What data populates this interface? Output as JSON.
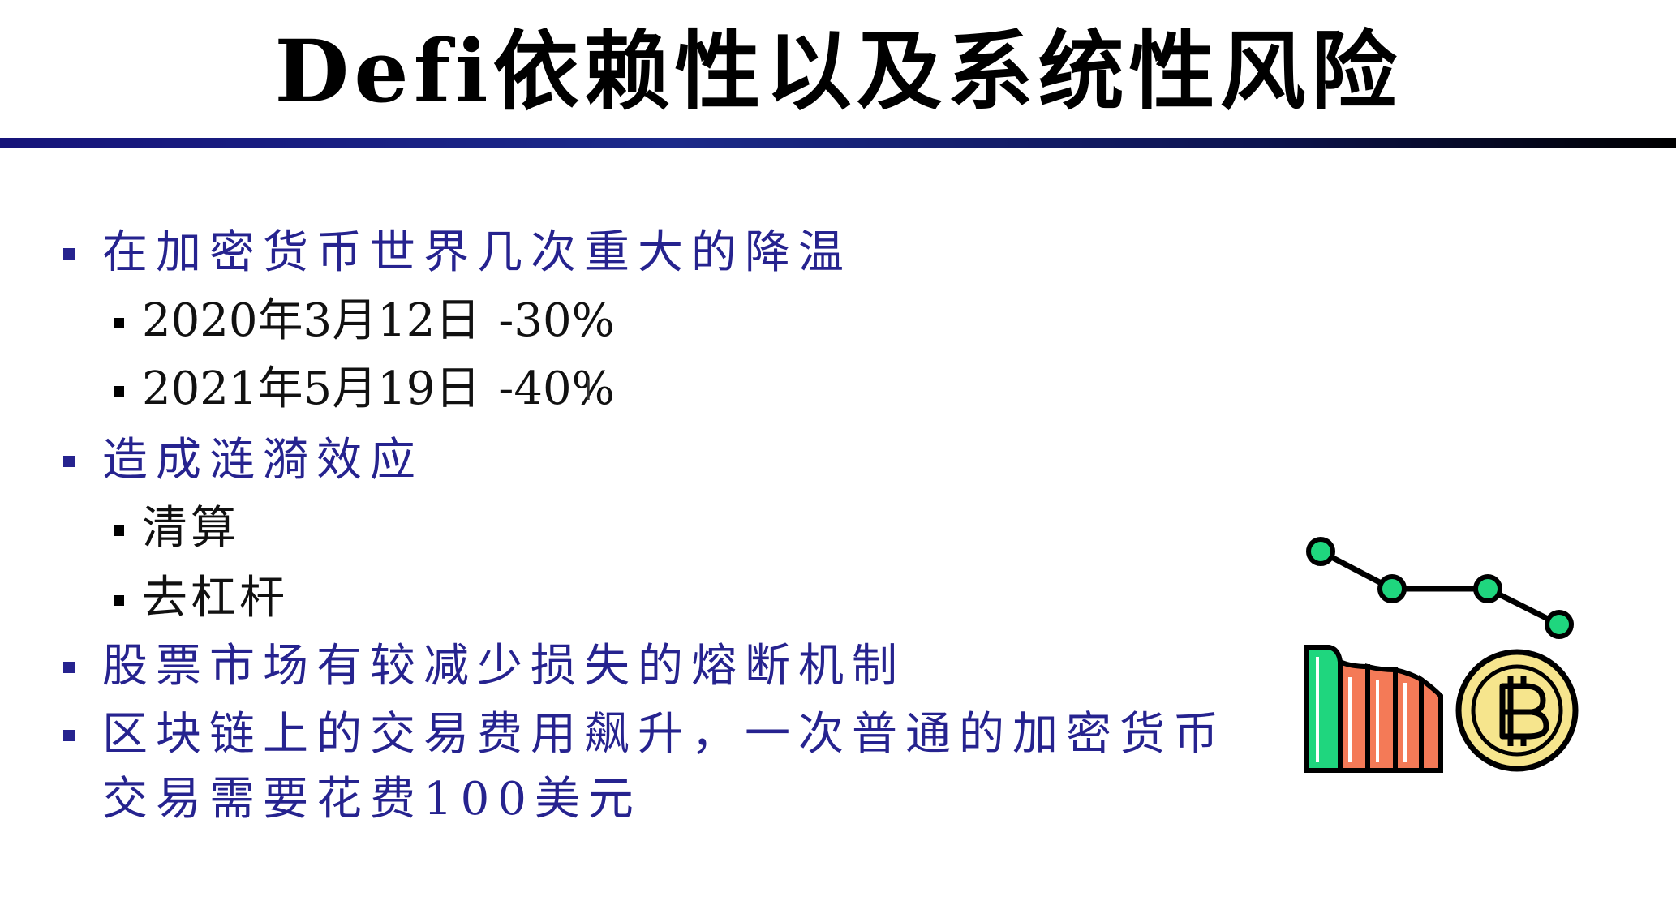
{
  "title": "Defi依赖性以及系统性风险",
  "bullets": [
    {
      "text": "在加密货币世界几次重大的降温",
      "children": [
        {
          "date": "2020年3月12日",
          "change": "-30%"
        },
        {
          "date": "2021年5月19日",
          "change": "-40%"
        }
      ]
    },
    {
      "text": "造成涟漪效应",
      "children": [
        {
          "text": "清算"
        },
        {
          "text": "去杠杆"
        }
      ]
    },
    {
      "text": "股票市场有较减少损失的熔断机制"
    },
    {
      "text": "区块链上的交易费用飙升，一次普通的加密货币交易需要花费100美元"
    }
  ],
  "illustration": {
    "icons": [
      "falling-line-chart-icon",
      "bar-chart-icon",
      "bitcoin-coin-icon"
    ],
    "colors": {
      "dot": "#1fd67e",
      "bar_green": "#1fd67e",
      "bar_orange": "#f47a57",
      "coin": "#f6e58d",
      "outline": "#000000"
    }
  },
  "colors": {
    "bullet_text": "#26238f",
    "sub_text": "#111111",
    "rule_start": "#16147a",
    "rule_end": "#000000"
  }
}
